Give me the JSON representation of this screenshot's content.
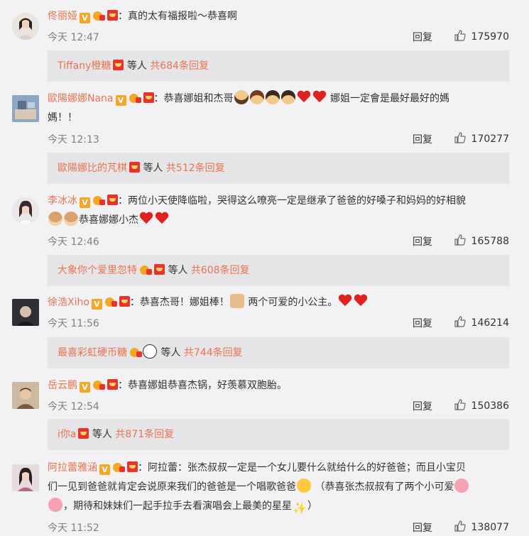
{
  "reply_label": "回复",
  "comments": [
    {
      "user": "佟丽娅",
      "text": "：真的太有福报啦～恭喜啊",
      "time": "今天 12:47",
      "likes": "175970",
      "sub": {
        "user": "Tiffany橙糖",
        "etc": "等人",
        "more": "共684条回复"
      }
    },
    {
      "user": "歐陽娜娜Nana",
      "text_a": "：恭喜娜姐和杰哥",
      "text_b": "娜姐一定會是最好最好的媽",
      "text_c": "媽！！",
      "time": "今天 12:13",
      "likes": "170277",
      "sub": {
        "user": "歐陽娜比的芃棋",
        "etc": "等人",
        "more": "共512条回复"
      }
    },
    {
      "user": "李冰冰",
      "text_a": "：两位小天使降临啦，哭得这么嘹亮一定是继承了爸爸的好嗓子和妈妈的好相貌",
      "text_b": "恭喜娜娜小杰",
      "time": "今天 12:46",
      "likes": "165788",
      "sub": {
        "user": "大象你个爱里忽特",
        "etc": "等人",
        "more": "共608条回复"
      }
    },
    {
      "user": "徐浩Xiho",
      "text_a": "：恭喜杰哥！娜姐棒！",
      "text_b": "两个可爱的小公主。",
      "time": "今天 11:56",
      "likes": "146214",
      "sub": {
        "user": "最喜彩虹硬币糖",
        "etc": "等人",
        "more": "共744条回复"
      }
    },
    {
      "user": "岳云鹏",
      "text": "：恭喜娜姐恭喜杰锅，好羡慕双胞胎。",
      "time": "今天 12:54",
      "likes": "150386",
      "sub": {
        "user": "i你a",
        "etc": "等人",
        "more": "共871条回复"
      }
    },
    {
      "user": "阿拉蕾雅涵",
      "text_a": "：阿拉蕾：张杰叔叔一定是一个女儿要什么就给什么的好爸爸；而且小宝贝",
      "text_b": "们一见到爸爸就肯定会说原来我们的爸爸是一个唱歌爸爸",
      "text_c": "（恭喜张杰叔叔有了两个小可爱",
      "text_d": "，期待和妹妹们一起手拉手去看演唱会上最美的星星",
      "text_e": "）",
      "time": "今天 11:52",
      "likes": "138077"
    }
  ],
  "icons": {
    "verified": "verified-v-badge",
    "red_envelope": "red-envelope-badge",
    "fan": "fan-badge",
    "like": "thumbs-up-icon"
  },
  "colors": {
    "username": "#eb7350",
    "background": "#f2f2f4",
    "reply_box": "#e5e5e8"
  }
}
